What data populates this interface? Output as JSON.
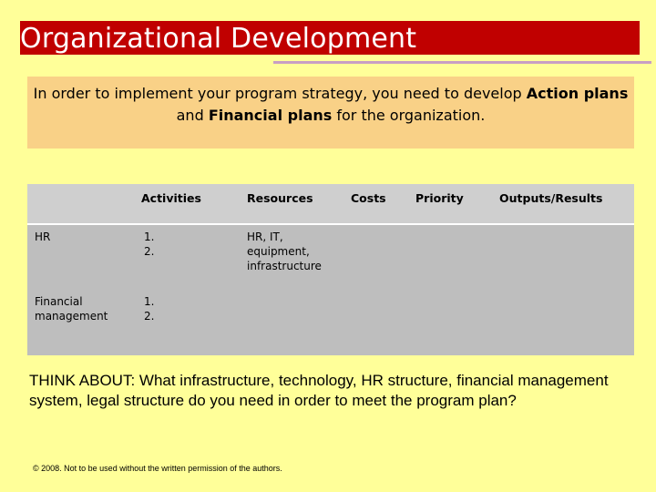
{
  "slide": {
    "title": "Organizational Development",
    "intro": {
      "text_1": "In order to implement your program strategy, you need to develop ",
      "bold_1": "Action plans",
      "text_2": " and ",
      "bold_2": "Financial plans",
      "text_3": " for the organization."
    },
    "table": {
      "headers": [
        "",
        "Activities",
        "Resources",
        "Costs",
        "Priority",
        "Outputs/Results"
      ],
      "rows": [
        {
          "area": "HR",
          "activities": [
            "1.",
            "2."
          ],
          "resources": [
            "HR, IT,",
            "equipment,",
            "infrastructure"
          ]
        },
        {
          "area_lines": [
            "Financial",
            "management"
          ],
          "activities": [
            "1.",
            "2."
          ]
        }
      ]
    },
    "think_about": "THINK ABOUT: What infrastructure, technology, HR structure, financial management system, legal structure do you need in order to meet the program plan?",
    "copyright": "© 2008. Not to be used without the written permission of the authors."
  },
  "colors": {
    "background": "#FFFF99",
    "title_bar": "#C00000",
    "title_rule": "#C89FC4",
    "intro_box": "#F9D187",
    "table_header": "#CFCFCF",
    "table_body": "#BEBEBE"
  }
}
